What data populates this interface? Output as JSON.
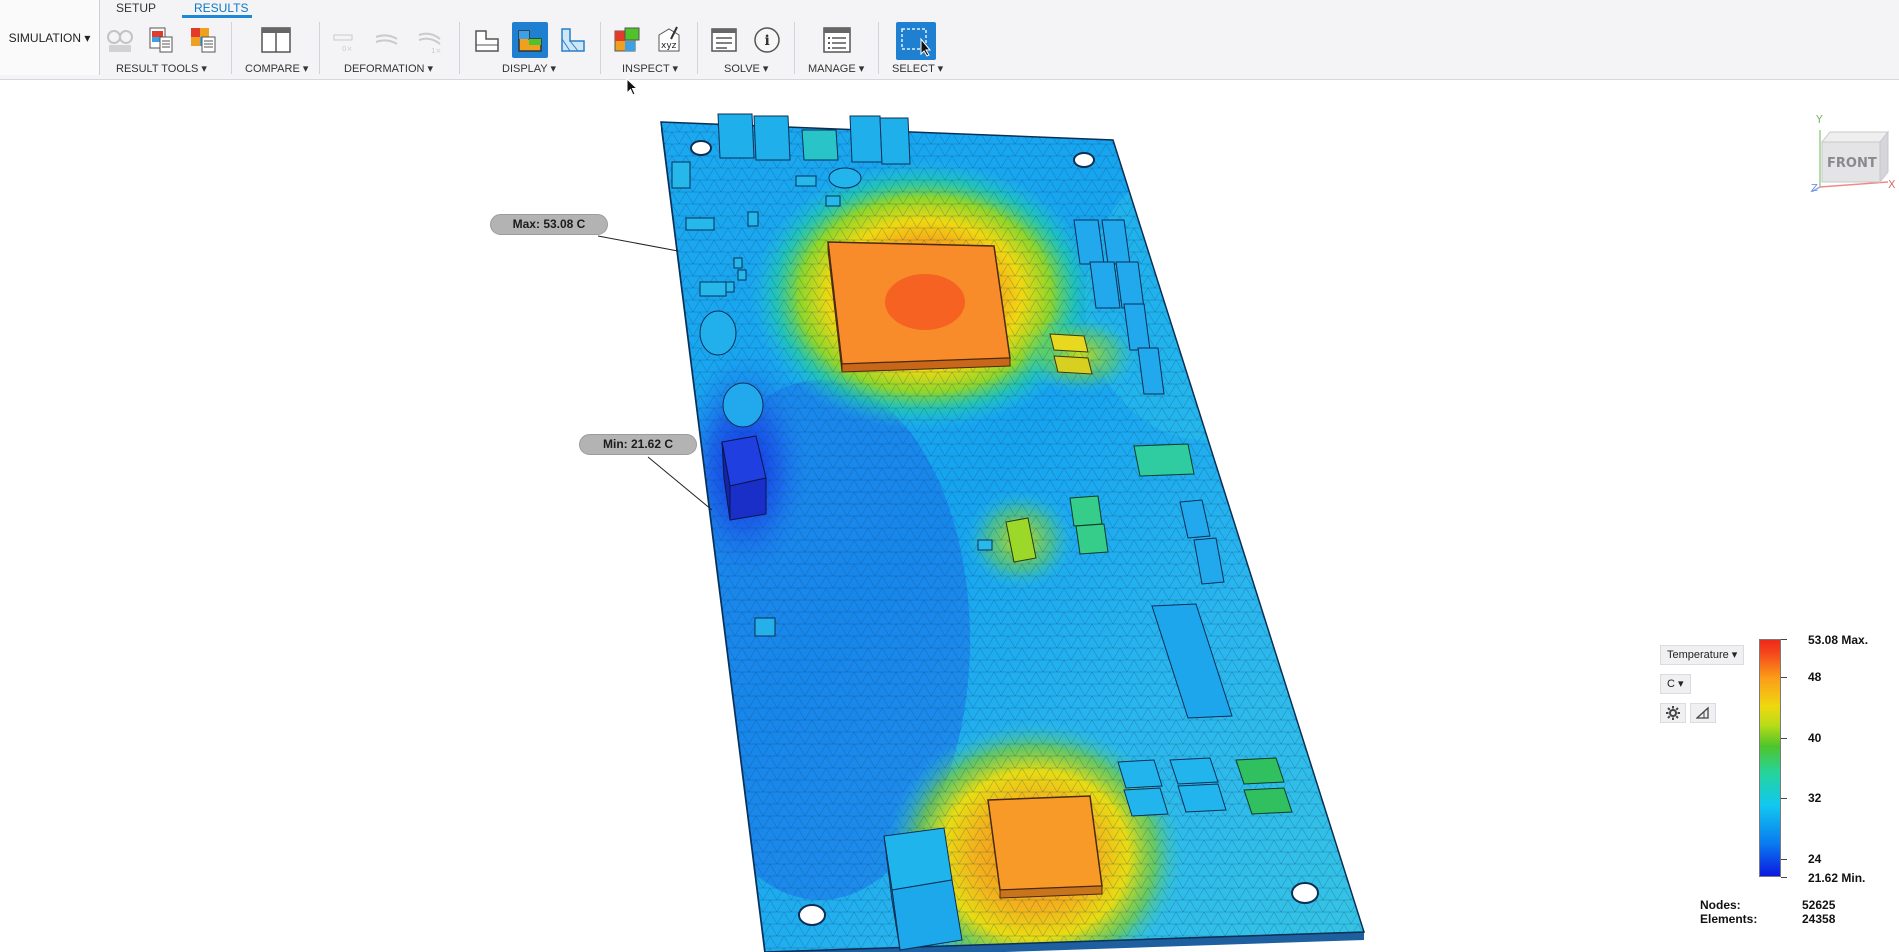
{
  "tabs": {
    "setup": "SETUP",
    "results": "RESULTS"
  },
  "workspace": {
    "label": "SIMULATION ▾"
  },
  "groups": {
    "result_tools": "RESULT TOOLS ▾",
    "compare": "COMPARE ▾",
    "deformation": "DEFORMATION ▾",
    "display": "DISPLAY ▾",
    "inspect": "INSPECT ▾",
    "solve": "SOLVE ▾",
    "manage": "MANAGE ▾",
    "select": "SELECT ▾"
  },
  "icons": {
    "inspect_xyz": "xyz",
    "info": "i"
  },
  "probes": {
    "max": "Max: 53.08 C",
    "min": "Min: 21.62 C"
  },
  "viewcube": {
    "face": "FRONT",
    "axis_x": "X",
    "axis_y": "Y",
    "axis_z": "Z"
  },
  "legend": {
    "quantity": "Temperature ▾",
    "unit": "C ▾",
    "max_label": "53.08 Max.",
    "min_label": "21.62 Min.",
    "ticks": [
      "48",
      "40",
      "32",
      "24"
    ],
    "tick_values": [
      48,
      40,
      32,
      24
    ],
    "range": [
      21.62,
      53.08
    ],
    "colors": [
      "#0b1ae0",
      "#11c8f0",
      "#4fc42a",
      "#f0d810",
      "#ee2a1a"
    ]
  },
  "stats": {
    "nodes_label": "Nodes:",
    "nodes_value": "52625",
    "elements_label": "Elements:",
    "elements_value": "24358"
  },
  "accent": "#1f7fd1"
}
